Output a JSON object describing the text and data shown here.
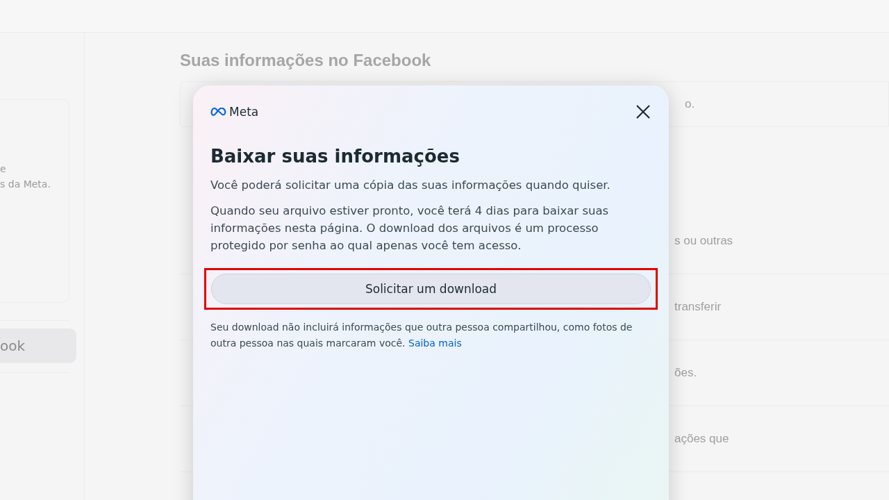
{
  "background": {
    "sidebar": {
      "card_lines": [
        "e",
        "s da Meta."
      ],
      "items": [
        {
          "label": "ook",
          "selected": true
        }
      ]
    },
    "main": {
      "title": "Suas informações no Facebook",
      "rows": [
        {
          "kind": "card",
          "right": "o."
        },
        {
          "kind": "row",
          "right": "s ou outras"
        },
        {
          "kind": "row",
          "right": "transferir"
        },
        {
          "kind": "row",
          "right": "ões."
        },
        {
          "kind": "row",
          "right": "ações que"
        }
      ]
    }
  },
  "dialog": {
    "brand": "Meta",
    "title": "Baixar suas informações",
    "intro": "Você poderá solicitar uma cópia das suas informações quando quiser.",
    "body": "Quando seu arquivo estiver pronto, você terá 4 dias para baixar suas informações nesta página. O download dos arquivos é um processo protegido por senha ao qual apenas você tem acesso.",
    "button": {
      "label": "Solicitar um download",
      "highlighted": true
    },
    "note": "Seu download não incluirá informações que outra pessoa compartilhou, como fotos de outra pessoa nas quais marcaram você.",
    "link": "Saiba mais"
  }
}
